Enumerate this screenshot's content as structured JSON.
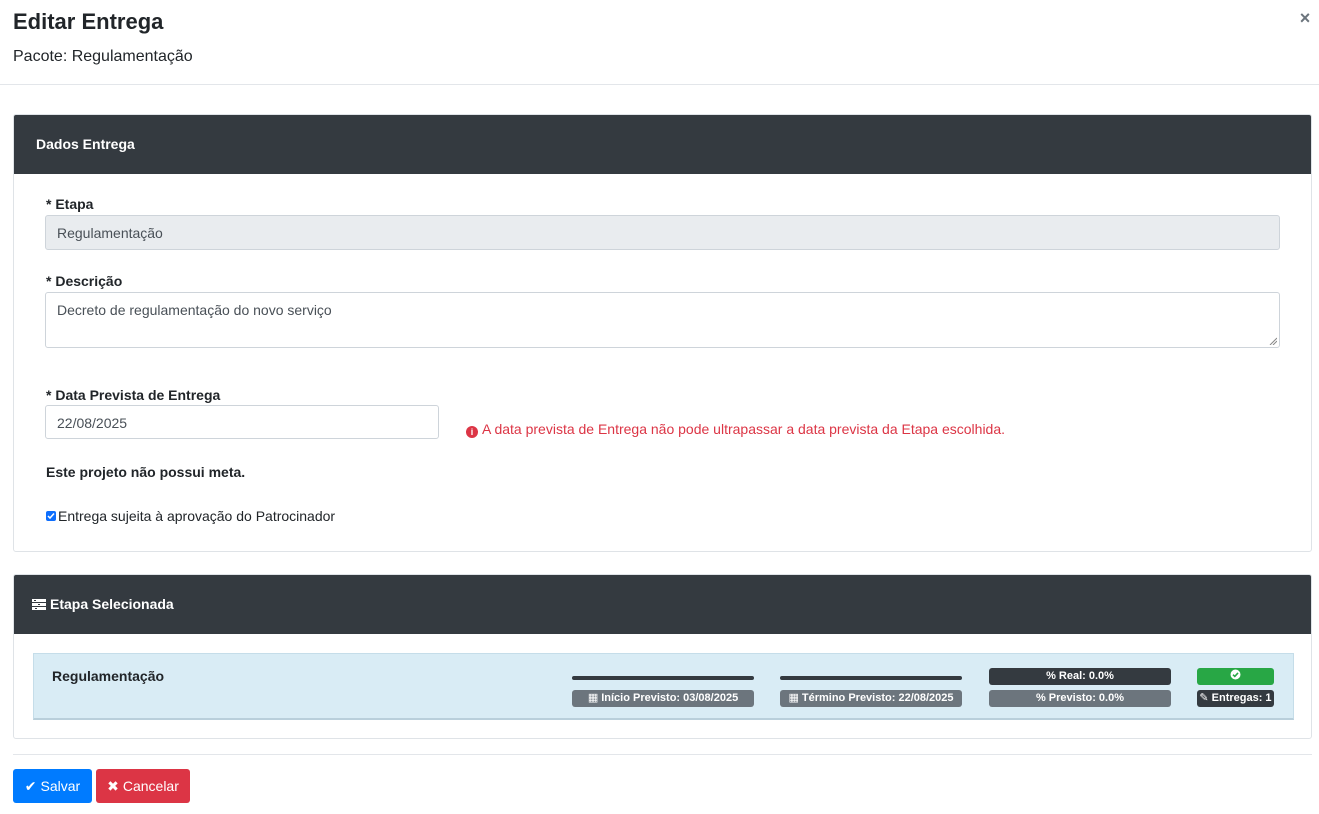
{
  "modal": {
    "title": "Editar Entrega",
    "subtitle": "Pacote: Regulamentação",
    "close_icon": "×"
  },
  "dados_entrega": {
    "header": "Dados Entrega",
    "etapa": {
      "label": "* Etapa",
      "value": "Regulamentação"
    },
    "descricao": {
      "label": "* Descrição",
      "value": "Decreto de regulamentação do novo serviço"
    },
    "data_prevista": {
      "label": "* Data Prevista de Entrega",
      "value": "22/08/2025",
      "error": "A data prevista de Entrega não pode ultrapassar a data prevista da Etapa escolhida."
    },
    "meta_text": "Este projeto não possui meta.",
    "aprovacao": {
      "label": "Entrega sujeita à aprovação do Patrocinador",
      "checked": true
    }
  },
  "etapa_selecionada": {
    "header": "Etapa Selecionada",
    "name": "Regulamentação",
    "inicio_previsto": "Início Previsto: 03/08/2025",
    "termino_previsto": "Término Previsto: 22/08/2025",
    "real": "% Real: 0.0%",
    "previsto": "% Previsto: 0.0%",
    "entregas": "Entregas: 1",
    "real_percent": 0.0,
    "previsto_percent": 0.0,
    "status_icon": "check-circle-icon"
  },
  "footer": {
    "save_label": "Salvar",
    "cancel_label": "Cancelar"
  },
  "colors": {
    "header_dark": "#343a40",
    "primary": "#007bff",
    "danger": "#dc3545",
    "success": "#28a745",
    "highlight_bg": "#d9ecf5"
  }
}
